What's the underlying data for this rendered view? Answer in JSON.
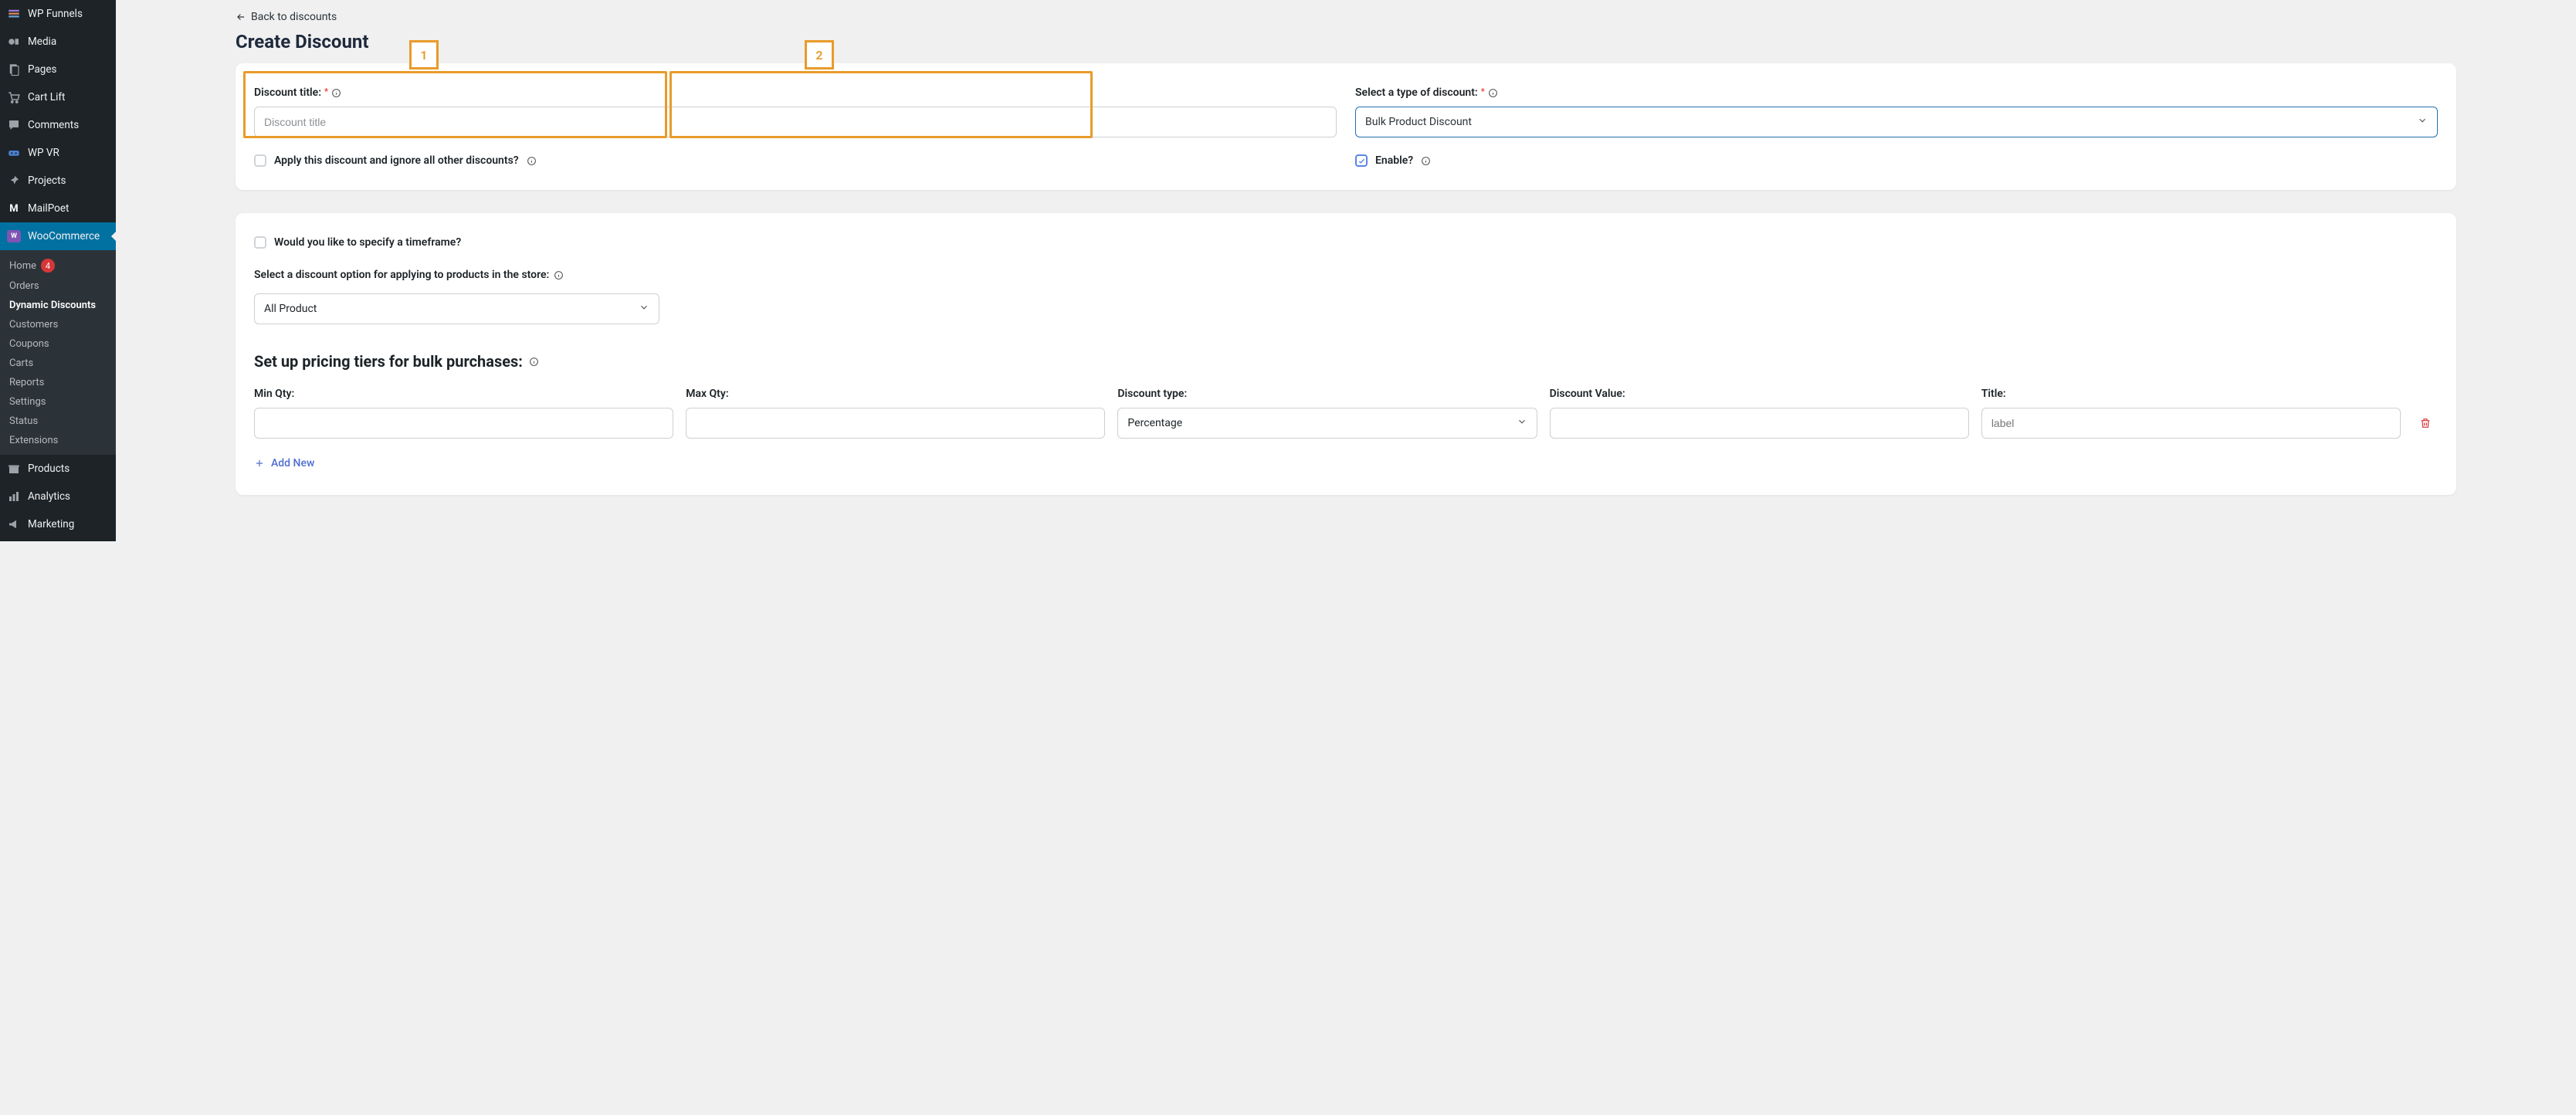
{
  "sidebar": {
    "items": [
      {
        "label": "WP Funnels"
      },
      {
        "label": "Media"
      },
      {
        "label": "Pages"
      },
      {
        "label": "Cart Lift"
      },
      {
        "label": "Comments"
      },
      {
        "label": "WP VR"
      },
      {
        "label": "Projects"
      },
      {
        "label": "MailPoet"
      },
      {
        "label": "WooCommerce"
      },
      {
        "label": "Products"
      },
      {
        "label": "Analytics"
      },
      {
        "label": "Marketing"
      }
    ],
    "sub": [
      {
        "label": "Home",
        "badge": "4"
      },
      {
        "label": "Orders"
      },
      {
        "label": "Dynamic Discounts"
      },
      {
        "label": "Customers"
      },
      {
        "label": "Coupons"
      },
      {
        "label": "Carts"
      },
      {
        "label": "Reports"
      },
      {
        "label": "Settings"
      },
      {
        "label": "Status"
      },
      {
        "label": "Extensions"
      }
    ]
  },
  "back_label": "Back to discounts",
  "page_title": "Create Discount",
  "callouts": {
    "one": "1",
    "two": "2"
  },
  "card1": {
    "title_label": "Discount title:",
    "title_placeholder": "Discount title",
    "type_label": "Select a type of discount:",
    "type_value": "Bulk Product Discount",
    "apply_label": "Apply this discount and ignore all other discounts?",
    "enable_label": "Enable?"
  },
  "card2": {
    "timeframe_label": "Would you like to specify a timeframe?",
    "option_label": "Select a discount option for applying to products in the store:",
    "option_value": "All Product",
    "tiers_title": "Set up pricing tiers for bulk purchases:",
    "cols": {
      "min": "Min Qty:",
      "max": "Max Qty:",
      "type": "Discount type:",
      "value": "Discount Value:",
      "title": "Title:"
    },
    "tier_type_value": "Percentage",
    "tier_title_placeholder": "label",
    "add_new": "Add New"
  }
}
